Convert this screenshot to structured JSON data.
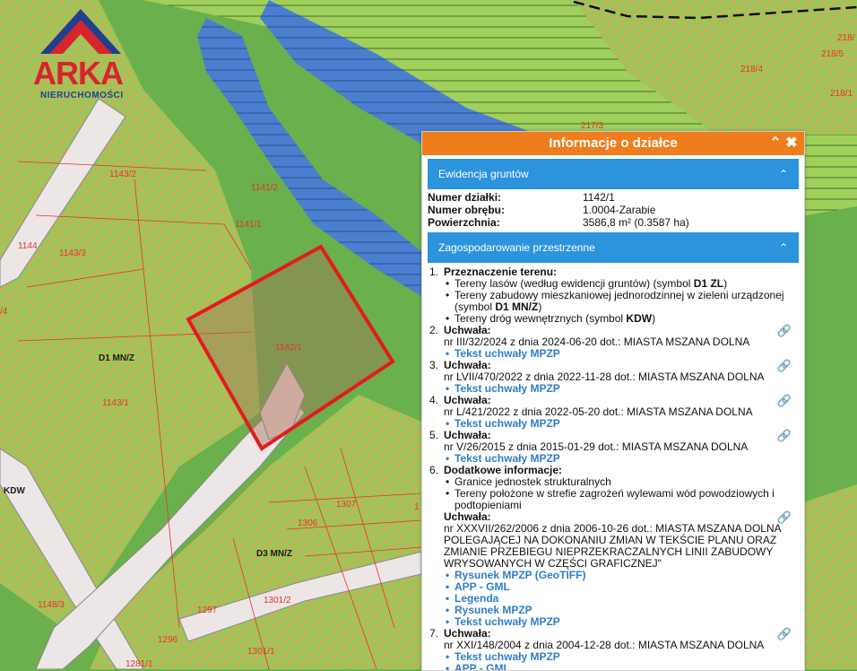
{
  "brand": {
    "name": "ARKA",
    "subtitle": "NIERUCHOMOŚCI"
  },
  "map": {
    "parcel_labels": [
      "1143/2",
      "1143/3",
      "1144",
      "1143/1",
      "1141/2",
      "1141/1",
      "1142/1",
      "217/3",
      "218/4",
      "218/5",
      "218/1",
      "218/",
      "1306",
      "1307",
      "1297",
      "1296",
      "1301/2",
      "1301/1",
      "1281/1",
      "1148/3",
      "/4",
      "1",
      "1"
    ],
    "zone_labels": [
      "D1 MN/Z",
      "KDW",
      "D3 MN/Z"
    ],
    "colors": {
      "forest": "#6ab04c",
      "residential": "#9dc55b",
      "water": "#4a7fd0",
      "road": "#e8e1e1",
      "selection": "#e31b1b",
      "parcel_line": "#e8322a"
    }
  },
  "panel": {
    "title": "Informacje o działce",
    "collapse_icon": "chevron-up-icon",
    "close_icon": "close-icon",
    "sec1": "Ewidencja gruntów",
    "fields": [
      {
        "label": "Numer działki:",
        "value": "1142/1"
      },
      {
        "label": "Numer obrębu:",
        "value": "1.0004-Zarabie"
      },
      {
        "label": "Powierzchnia:",
        "value": "3586,8 m² (0.3587 ha)"
      }
    ],
    "sec2": "Zagospodarowanie przestrzenne",
    "i1": {
      "num": "1.",
      "title": "Przeznaczenie terenu:",
      "b1a": "Tereny lasów (według ewidencji gruntów) (symbol ",
      "b1b": "D1 ZL",
      "b1c": ")",
      "b2a": "Tereny zabudowy mieszkaniowej jednorodzinnej w zieleni urządzonej (symbol ",
      "b2b": "D1 MN/Z",
      "b2c": ")",
      "b3a": "Tereny dróg wewnętrznych (symbol ",
      "b3b": "KDW",
      "b3c": ")"
    },
    "i2": {
      "num": "2.",
      "title": "Uchwała:",
      "text": "nr III/32/2024 z dnia 2024-06-20 dot.: MIASTA MSZANA DOLNA",
      "link": "Tekst uchwały MPZP"
    },
    "i3": {
      "num": "3.",
      "title": "Uchwała:",
      "text": "nr LVII/470/2022 z dnia 2022-11-28 dot.: MIASTA MSZANA DOLNA",
      "link": "Tekst uchwały MPZP"
    },
    "i4": {
      "num": "4.",
      "title": "Uchwała:",
      "text": "nr L/421/2022 z dnia 2022-05-20 dot.: MIASTA MSZANA DOLNA",
      "link": "Tekst uchwały MPZP"
    },
    "i5": {
      "num": "5.",
      "title": "Uchwała:",
      "text": "nr V/26/2015 z dnia 2015-01-29 dot.: MIASTA MSZANA DOLNA",
      "link": "Tekst uchwały MPZP"
    },
    "i6": {
      "num": "6.",
      "title": "Dodatkowe informacje:",
      "b1": "Granice jednostek strukturalnych",
      "b2": "Tereny położone w strefie zagrożeń wylewami wód powodziowych i podtopieniami",
      "sub_title": "Uchwała:",
      "sub_text": "nr XXXVII/262/2006 z dnia 2006-10-26 dot.: MIASTA MSZANA DOLNA POLEGAJĄCEJ NA DOKONANIU ZMIAN W TEKŚCIE PLANU ORAZ ZMIANIE PRZEBIEGU NIEPRZEKRACZALNYCH LINII ZABUDOWY WRYSOWANYCH W CZĘŚCI GRAFICZNEJ\"",
      "links": [
        "Rysunek MPZP (GeoTIFF)",
        "APP - GML",
        "Legenda",
        "Rysunek MPZP",
        "Tekst uchwały MPZP"
      ]
    },
    "i7": {
      "num": "7.",
      "title": "Uchwała:",
      "text": "nr XXI/148/2004 z dnia 2004-12-28 dot.: MIASTA MSZANA DOLNA",
      "links": [
        "Tekst uchwały MPZP",
        "APP - GML"
      ]
    }
  }
}
